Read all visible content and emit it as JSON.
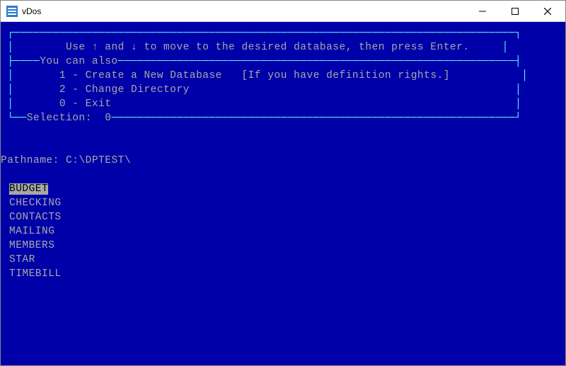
{
  "window": {
    "title": "vDos"
  },
  "instruction": "Use ↑ and ↓ to move to the desired database, then press Enter.",
  "options_header": "You can also",
  "options": [
    {
      "key": "1",
      "label": "Create a New Database",
      "note": "[If you have definition rights.]"
    },
    {
      "key": "2",
      "label": "Change Directory",
      "note": ""
    },
    {
      "key": "0",
      "label": "Exit",
      "note": ""
    }
  ],
  "selection_label": "Selection:",
  "selection_value": "0",
  "pathname_label": "Pathname:",
  "pathname_value": "C:\\DPTEST\\",
  "databases": [
    "BUDGET",
    "CHECKING",
    "CONTACTS",
    "MAILING",
    "MEMBERS",
    "STAR",
    "TIMEBILL"
  ],
  "selected_db_index": 0
}
